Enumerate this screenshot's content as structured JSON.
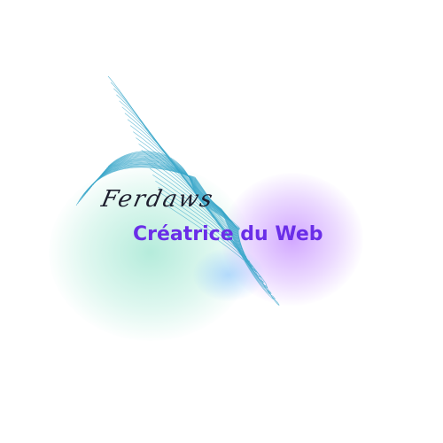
{
  "logo": {
    "signature": "Ferdaws",
    "tagline": "Créatrice du Web",
    "colors": {
      "tagline": "#6a2ee8",
      "signature": "#1e1e2e",
      "wave_line": "#3aa7c9",
      "glow_teal": "#8fe0c6",
      "glow_purple": "#b985ff"
    }
  }
}
